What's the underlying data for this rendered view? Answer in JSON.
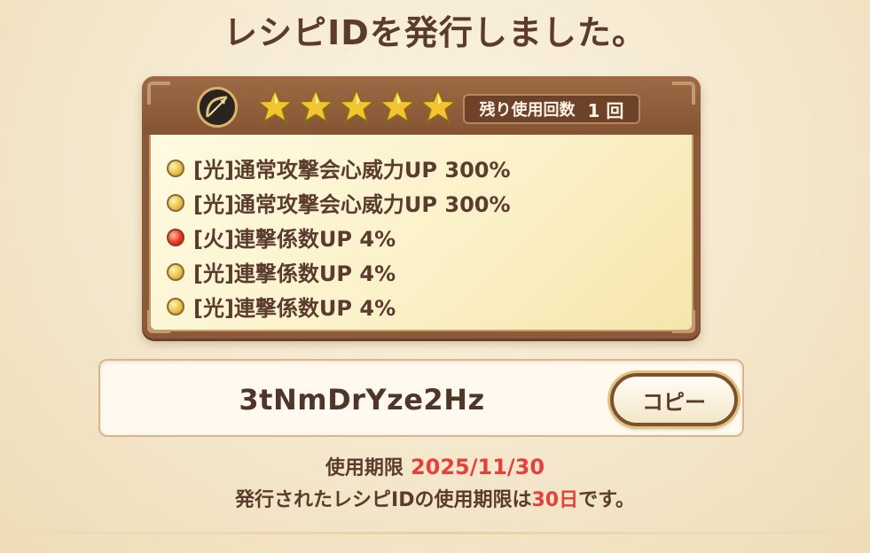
{
  "title": "レシピIDを発行しました。",
  "card": {
    "class_icon": "bow-icon",
    "star_count": 5,
    "star_color": "#f4c430",
    "uses_label": "残り使用回数",
    "uses_count": "1 回",
    "skills": [
      {
        "orb": "light",
        "text": "[光]通常攻撃会心威力UP 300%"
      },
      {
        "orb": "light",
        "text": "[光]通常攻撃会心威力UP 300%"
      },
      {
        "orb": "fire",
        "text": "[火]連撃係数UP 4%"
      },
      {
        "orb": "light",
        "text": "[光]連撃係数UP 4%"
      },
      {
        "orb": "light",
        "text": "[光]連撃係数UP 4%"
      }
    ]
  },
  "recipe_id": {
    "value": "3tNmDrYze2Hz",
    "copy_label": "コピー"
  },
  "expiry": {
    "label": "使用期限",
    "date": "2025/11/30"
  },
  "note": {
    "prefix": "発行されたレシピIDの使用期限は",
    "days": "30日",
    "suffix": "です。"
  },
  "colors": {
    "accent_red": "#e4413b",
    "text_brown": "#5b3b2e"
  }
}
